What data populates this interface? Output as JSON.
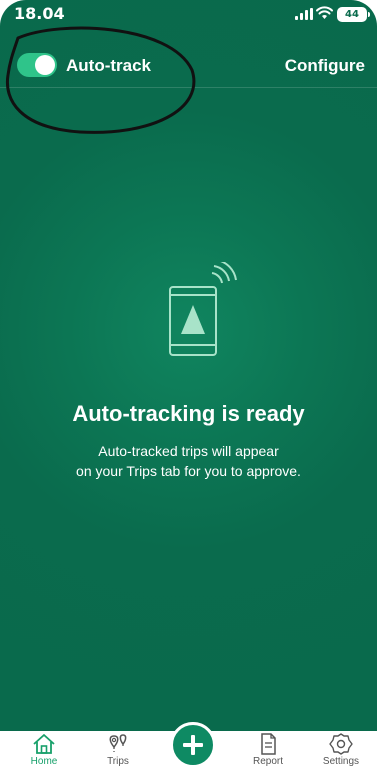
{
  "status_bar": {
    "time": "18.04",
    "battery": "44",
    "icons": [
      "signal-icon",
      "wifi-icon",
      "battery-icon"
    ]
  },
  "header": {
    "toggle_label": "Auto-track",
    "toggle_on": true,
    "configure_label": "Configure"
  },
  "empty_state": {
    "illustration": "phone-navigation-icon",
    "title": "Auto-tracking is ready",
    "desc_line1": "Auto-tracked trips will appear",
    "desc_line2": "on your Trips tab for you to approve."
  },
  "nav": {
    "items": [
      {
        "label": "Home",
        "icon": "home-icon",
        "active": true
      },
      {
        "label": "Trips",
        "icon": "trips-icon",
        "active": false
      },
      {
        "label": "",
        "icon": "plus-icon",
        "active": false
      },
      {
        "label": "Report",
        "icon": "report-icon",
        "active": false
      },
      {
        "label": "Settings",
        "icon": "settings-icon",
        "active": false
      }
    ]
  },
  "colors": {
    "primary_green": "#0a6b4d",
    "toggle_green": "#2fc48a",
    "active_nav": "#17a06a",
    "fab_green": "#0e8a63"
  }
}
